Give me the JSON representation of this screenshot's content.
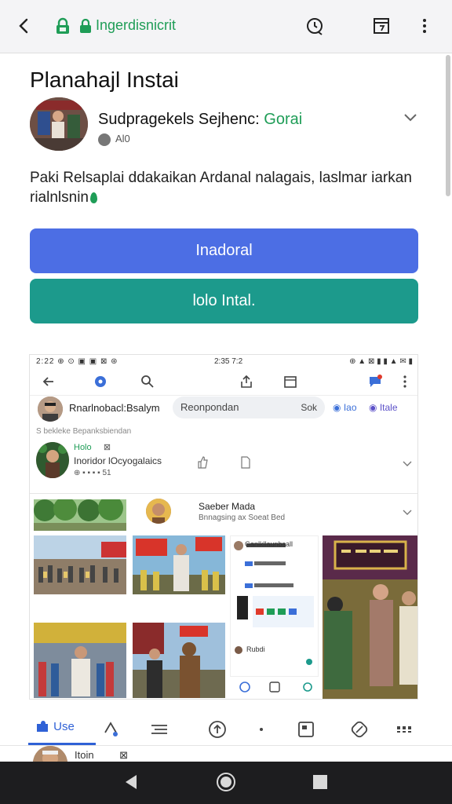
{
  "browser": {
    "url": "Ingerdisnicrit"
  },
  "page": {
    "title": "Planahajl Instai",
    "app_name": "Sudpragekels Sejhenc:",
    "app_category": "Gorai",
    "app_meta": "Al0",
    "description": "Paki Relsaplai ddakaikan Ardanal nalagais, laslmar iarkan rialnlsnin",
    "primary_button": "Inadoral",
    "secondary_button": "lolo Intal."
  },
  "screenshot": {
    "status_left": "2:22 ⊕ ⊙ ▣ ▣ ⊠ ⊛",
    "status_center": "2:35 7:2",
    "status_right": "⊕ ▲ ⊠ ▮ ▮ ▲ ✉ ▮",
    "profile_name": "Rnarlnobacl:Bsalym",
    "search_text": "Reonpondan",
    "search_action": "Sok",
    "chip_1": "Iao",
    "chip_2": "Itale",
    "breadcrumb": "S bekleke Bepanksbiendan",
    "post_title": "Holo",
    "post_title_icon": "⊠",
    "post_subtitle": "Inoridor lOcyogalaics",
    "post_meta": "⊕ ▪ ▪ ▪ ▪ 51",
    "author_name": "Saeber Mada",
    "author_subtitle": "Bnnagsing ax Soeat Bed",
    "chat_title": "Ganlkllaunbsall",
    "chat_footer": "Rubdi"
  },
  "tabs": [
    {
      "label": "Use"
    },
    {
      "label": ""
    },
    {
      "label": ""
    },
    {
      "label": ""
    },
    {
      "label": ""
    },
    {
      "label": ""
    },
    {
      "label": ""
    },
    {
      "label": ""
    }
  ],
  "peek": {
    "name": "Itoin",
    "icon": "⊠"
  },
  "colors": {
    "accent_blue": "#4c6ee4",
    "accent_teal": "#1c9a8c",
    "accent_green": "#1f9d57",
    "tab_active": "#2f61d6"
  },
  "icons": [
    "back-icon",
    "lock-icon",
    "key-icon",
    "refresh-icon",
    "calendar-icon",
    "more-vert-icon",
    "chevron-down-icon",
    "globe-icon",
    "leaf-icon",
    "nav-back-icon",
    "nav-home-icon",
    "nav-recents-icon"
  ]
}
